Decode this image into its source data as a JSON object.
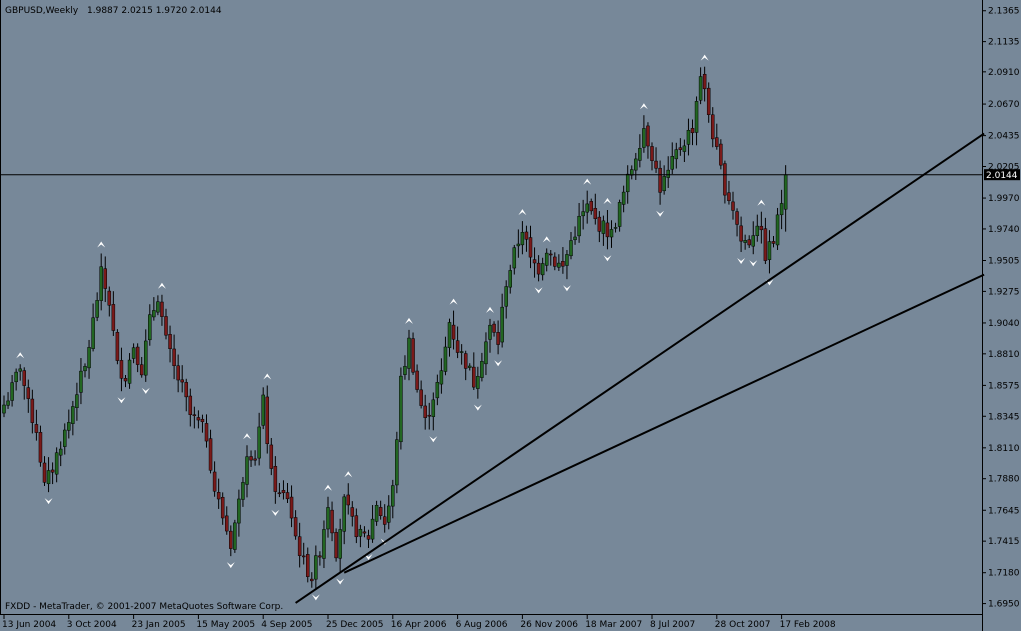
{
  "chart_data": {
    "type": "candlestick",
    "title": "GBPUSD,Weekly",
    "ohlc_header": "1.9887 2.0215 1.9720 2.0144",
    "symbol": "GBPUSD",
    "timeframe": "Weekly",
    "current_price": "2.0144",
    "copyright": "FXDD - MetaTrader, © 2001-2007 MetaQuotes Software Corp.",
    "ylim": [
      1.6865,
      2.1445
    ],
    "grid": false,
    "y_ticks": [
      "2.1365",
      "2.1135",
      "2.0910",
      "2.0670",
      "2.0435",
      "2.0205",
      "1.9970",
      "1.9740",
      "1.9505",
      "1.9275",
      "1.9040",
      "1.8810",
      "1.8575",
      "1.8345",
      "1.8110",
      "1.7880",
      "1.7645",
      "1.7415",
      "1.7180",
      "1.6950"
    ],
    "x_ticks": [
      {
        "label": "13 Jun 2004",
        "bar": 0
      },
      {
        "label": "3 Oct 2004",
        "bar": 16
      },
      {
        "label": "23 Jan 2005",
        "bar": 32
      },
      {
        "label": "15 May 2005",
        "bar": 48
      },
      {
        "label": "4 Sep 2005",
        "bar": 64
      },
      {
        "label": "25 Dec 2005",
        "bar": 80
      },
      {
        "label": "16 Apr 2006",
        "bar": 96
      },
      {
        "label": "6 Aug 2006",
        "bar": 112
      },
      {
        "label": "26 Nov 2006",
        "bar": 128
      },
      {
        "label": "18 Mar 2007",
        "bar": 144
      },
      {
        "label": "8 Jul 2007",
        "bar": 160
      },
      {
        "label": "28 Oct 2007",
        "bar": 176
      },
      {
        "label": "17 Feb 2008",
        "bar": 192
      }
    ],
    "close_anchors": [
      [
        0,
        1.843
      ],
      [
        2,
        1.855
      ],
      [
        4,
        1.873
      ],
      [
        6,
        1.842
      ],
      [
        8,
        1.825
      ],
      [
        10,
        1.782
      ],
      [
        12,
        1.796
      ],
      [
        14,
        1.815
      ],
      [
        16,
        1.83
      ],
      [
        18,
        1.855
      ],
      [
        20,
        1.87
      ],
      [
        22,
        1.905
      ],
      [
        24,
        1.94
      ],
      [
        26,
        1.92
      ],
      [
        28,
        1.872
      ],
      [
        30,
        1.865
      ],
      [
        32,
        1.888
      ],
      [
        34,
        1.87
      ],
      [
        36,
        1.905
      ],
      [
        38,
        1.925
      ],
      [
        40,
        1.89
      ],
      [
        42,
        1.87
      ],
      [
        44,
        1.855
      ],
      [
        46,
        1.835
      ],
      [
        48,
        1.829
      ],
      [
        50,
        1.82
      ],
      [
        52,
        1.78
      ],
      [
        54,
        1.76
      ],
      [
        56,
        1.74
      ],
      [
        58,
        1.77
      ],
      [
        60,
        1.81
      ],
      [
        62,
        1.805
      ],
      [
        64,
        1.845
      ],
      [
        66,
        1.79
      ],
      [
        68,
        1.775
      ],
      [
        70,
        1.775
      ],
      [
        72,
        1.745
      ],
      [
        74,
        1.725
      ],
      [
        76,
        1.715
      ],
      [
        78,
        1.735
      ],
      [
        80,
        1.77
      ],
      [
        82,
        1.735
      ],
      [
        84,
        1.77
      ],
      [
        86,
        1.755
      ],
      [
        88,
        1.745
      ],
      [
        90,
        1.745
      ],
      [
        92,
        1.77
      ],
      [
        94,
        1.755
      ],
      [
        96,
        1.78
      ],
      [
        98,
        1.86
      ],
      [
        100,
        1.89
      ],
      [
        102,
        1.855
      ],
      [
        104,
        1.83
      ],
      [
        106,
        1.85
      ],
      [
        108,
        1.865
      ],
      [
        110,
        1.905
      ],
      [
        112,
        1.885
      ],
      [
        114,
        1.875
      ],
      [
        116,
        1.86
      ],
      [
        118,
        1.88
      ],
      [
        120,
        1.9
      ],
      [
        122,
        1.89
      ],
      [
        124,
        1.935
      ],
      [
        126,
        1.955
      ],
      [
        128,
        1.975
      ],
      [
        130,
        1.95
      ],
      [
        132,
        1.945
      ],
      [
        134,
        1.96
      ],
      [
        136,
        1.95
      ],
      [
        138,
        1.945
      ],
      [
        140,
        1.965
      ],
      [
        142,
        1.98
      ],
      [
        144,
        1.99
      ],
      [
        146,
        1.98
      ],
      [
        148,
        1.975
      ],
      [
        150,
        1.97
      ],
      [
        152,
        1.99
      ],
      [
        154,
        2.01
      ],
      [
        156,
        2.03
      ],
      [
        158,
        2.05
      ],
      [
        160,
        2.03
      ],
      [
        162,
        2.005
      ],
      [
        164,
        2.015
      ],
      [
        166,
        2.03
      ],
      [
        168,
        2.04
      ],
      [
        170,
        2.05
      ],
      [
        172,
        2.09
      ],
      [
        174,
        2.06
      ],
      [
        176,
        2.03
      ],
      [
        178,
        2.005
      ],
      [
        180,
        1.99
      ],
      [
        182,
        1.965
      ],
      [
        184,
        1.965
      ],
      [
        186,
        1.98
      ],
      [
        188,
        1.955
      ],
      [
        190,
        1.965
      ],
      [
        192,
        1.995
      ],
      [
        193,
        2.0144
      ]
    ],
    "trendlines": [
      {
        "from": [
          72,
          1.6955
        ],
        "to": [
          242,
          2.045
        ]
      },
      {
        "from": [
          84,
          1.718
        ],
        "to": [
          242,
          1.94
        ]
      }
    ]
  }
}
